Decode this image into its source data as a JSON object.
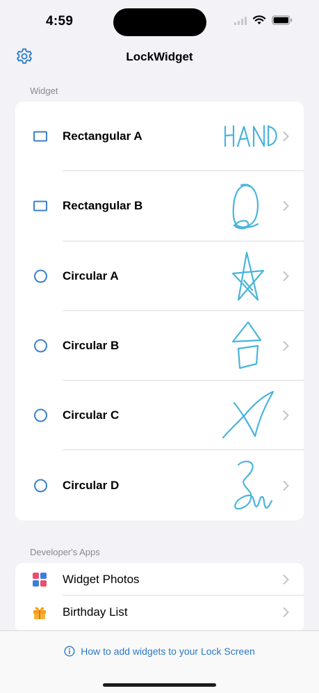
{
  "status_bar": {
    "time": "4:59"
  },
  "nav": {
    "title": "LockWidget"
  },
  "widget_section": {
    "header": "Widget",
    "items": [
      {
        "label": "Rectangular A",
        "shape": "rectangle",
        "sketch": "HAND"
      },
      {
        "label": "Rectangular B",
        "shape": "rectangle",
        "sketch": "loop-scribble"
      },
      {
        "label": "Circular A",
        "shape": "circle",
        "sketch": "star"
      },
      {
        "label": "Circular B",
        "shape": "circle",
        "sketch": "triangle-square"
      },
      {
        "label": "Circular C",
        "shape": "circle",
        "sketch": "arrow-scribble"
      },
      {
        "label": "Circular D",
        "shape": "circle",
        "sketch": "signature-scribble"
      }
    ]
  },
  "apps_section": {
    "header": "Developer's Apps",
    "items": [
      {
        "label": "Widget Photos",
        "icon": "photos-grid-icon"
      },
      {
        "label": "Birthday List",
        "icon": "gift-icon"
      }
    ]
  },
  "bottom_bar": {
    "help_text": "How to add widgets to your Lock Screen"
  },
  "colors": {
    "accent": "#2a78c8",
    "sketch": "#4ab4dc"
  }
}
